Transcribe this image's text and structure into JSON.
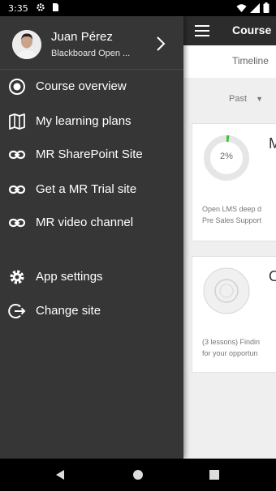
{
  "status_bar": {
    "time": "3:35",
    "left_icons": [
      "gear-icon",
      "sim-card-icon"
    ],
    "right_icons": [
      "wifi-icon",
      "signal-icon",
      "battery-icon"
    ]
  },
  "app": {
    "title": "Course",
    "tab": "Timeline",
    "filter": "Past",
    "cards": [
      {
        "title": "Mo",
        "progress_label": "2%",
        "progress": 0.02,
        "desc_lines": [
          "Open LMS deep d",
          "Pre Sales Support"
        ]
      },
      {
        "title": "Op",
        "progress_label": "",
        "progress": 0,
        "desc_lines": [
          "(3 lessons) Findin",
          "for your opportun"
        ]
      }
    ]
  },
  "drawer": {
    "user_name": "Juan Pérez",
    "site_name": "Blackboard Open ...",
    "items": [
      {
        "label": "Course overview",
        "icon": "radio-target-icon"
      },
      {
        "label": "My learning plans",
        "icon": "map-icon"
      },
      {
        "label": "MR SharePoint Site",
        "icon": "link-icon"
      },
      {
        "label": "Get a MR Trial site",
        "icon": "link-icon"
      },
      {
        "label": "MR video channel",
        "icon": "link-icon"
      },
      {
        "label": "App settings",
        "icon": "gear-icon"
      },
      {
        "label": "Change site",
        "icon": "logout-icon"
      }
    ]
  },
  "nav_bar": {
    "icons": [
      "back-icon",
      "home-icon",
      "recents-icon"
    ]
  },
  "colors": {
    "drawer_bg": "#363636",
    "app_bar": "#2c2c2c",
    "progress_green": "#3cc23c"
  }
}
